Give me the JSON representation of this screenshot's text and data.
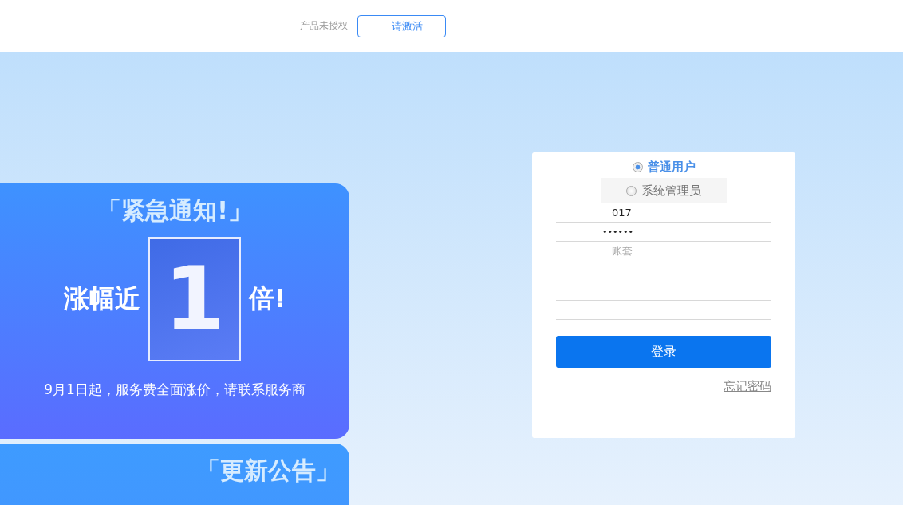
{
  "header": {
    "license_status": "产品未授权",
    "activate_button": "请激活"
  },
  "banners": [
    {
      "kind": "notice",
      "title": "「紧急通知!」",
      "headline_left": "涨幅近",
      "numeral": "1",
      "headline_right": "倍!",
      "caption": "9月1日起，服务费全面涨价，请联系服务商"
    },
    {
      "kind": "update",
      "title": "「更新公告」"
    }
  ],
  "login": {
    "roles": [
      {
        "label": "普通用户",
        "selected": true
      },
      {
        "label": "系统管理员",
        "selected": false
      }
    ],
    "fields": [
      {
        "kind": "text",
        "value": "017"
      },
      {
        "kind": "password",
        "value": "••••••"
      },
      {
        "kind": "select",
        "placeholder": "账套"
      },
      {
        "kind": "text"
      }
    ],
    "submit": "登录",
    "forgot_link": "忘记密码"
  }
}
